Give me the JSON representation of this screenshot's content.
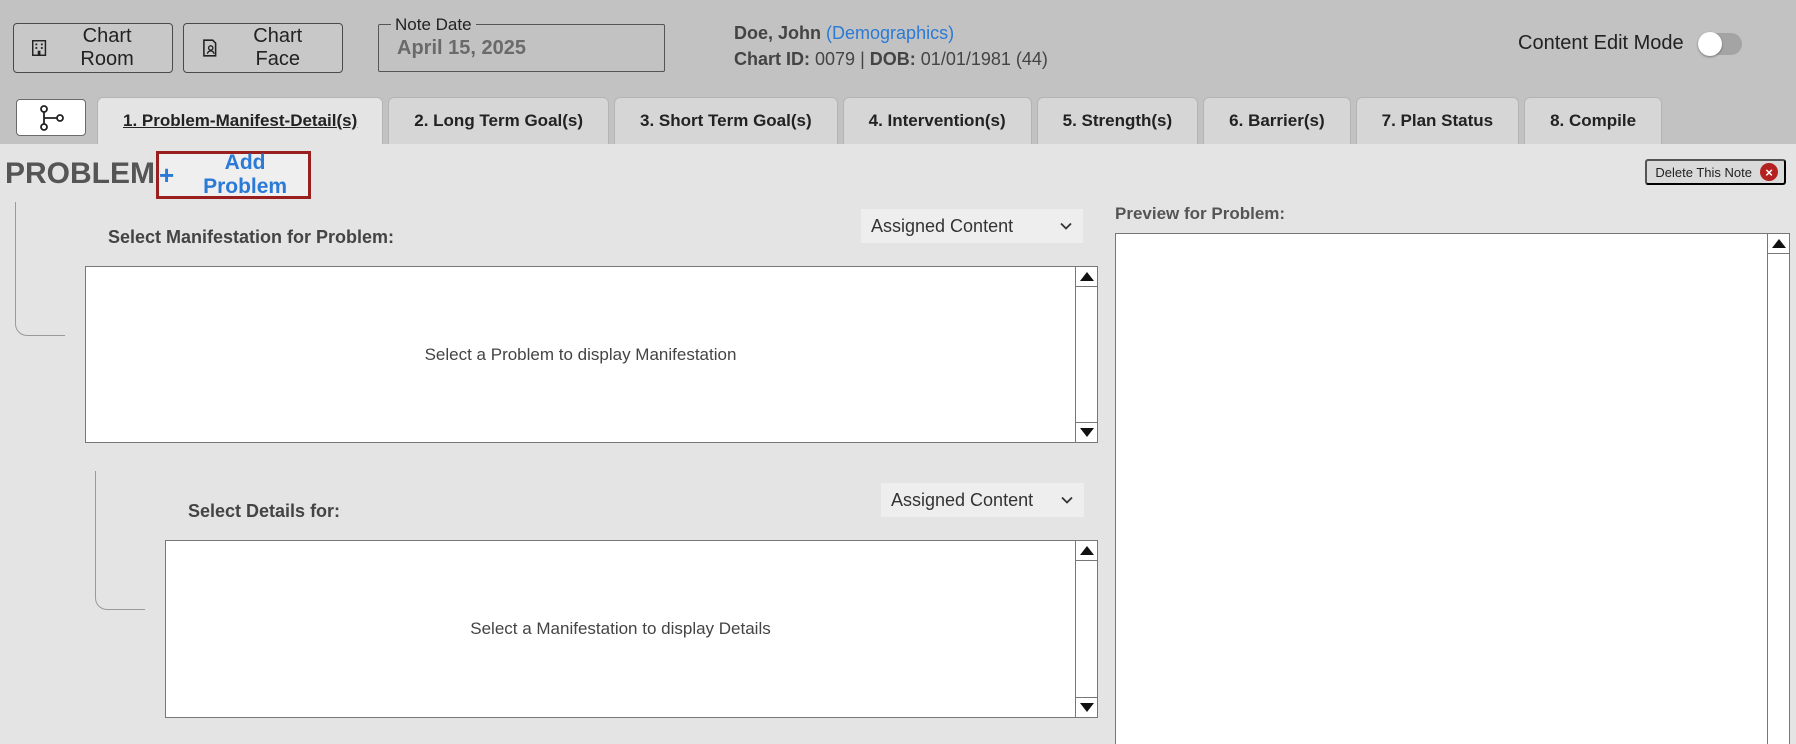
{
  "header": {
    "chart_room_label": "Chart Room",
    "chart_face_label": "Chart Face",
    "note_date_label": "Note Date",
    "note_date_value": "April 15, 2025",
    "patient_name": "Doe, John",
    "demographics_link": "(Demographics)",
    "chart_id_label": "Chart ID:",
    "chart_id_value": "0079",
    "separator": "|",
    "dob_label": "DOB:",
    "dob_value": "01/01/1981 (44)",
    "content_edit_mode_label": "Content Edit Mode",
    "content_edit_mode_on": false
  },
  "tabs": [
    {
      "label": "1. Problem-Manifest-Detail(s)",
      "active": true
    },
    {
      "label": "2. Long Term Goal(s)",
      "active": false
    },
    {
      "label": "3. Short Term Goal(s)",
      "active": false
    },
    {
      "label": "4. Intervention(s)",
      "active": false
    },
    {
      "label": "5. Strength(s)",
      "active": false
    },
    {
      "label": "6. Barrier(s)",
      "active": false
    },
    {
      "label": "7. Plan Status",
      "active": false
    },
    {
      "label": "8. Compile",
      "active": false
    }
  ],
  "problem": {
    "title": "PROBLEM:",
    "add_icon": "+",
    "add_label": "Add Problem",
    "delete_note_label": "Delete This Note",
    "delete_icon": "×"
  },
  "manifestation": {
    "label": "Select Manifestation for Problem:",
    "filter_value": "Assigned Content",
    "placeholder": "Select a Problem to display Manifestation"
  },
  "details": {
    "label": "Select Details for:",
    "filter_value": "Assigned Content",
    "placeholder": "Select a Manifestation to display Details"
  },
  "preview": {
    "label": "Preview for Problem:"
  },
  "colors": {
    "link": "#2a7ad6",
    "highlight_border": "#9a1f1f",
    "delete_icon_bg": "#b32121",
    "topbar_bg": "#c2c2c2"
  },
  "icons": {
    "chart_room": "building-icon",
    "chart_face": "person-document-icon",
    "workflow": "branch-icon",
    "dropdown": "chevron-down-icon"
  }
}
